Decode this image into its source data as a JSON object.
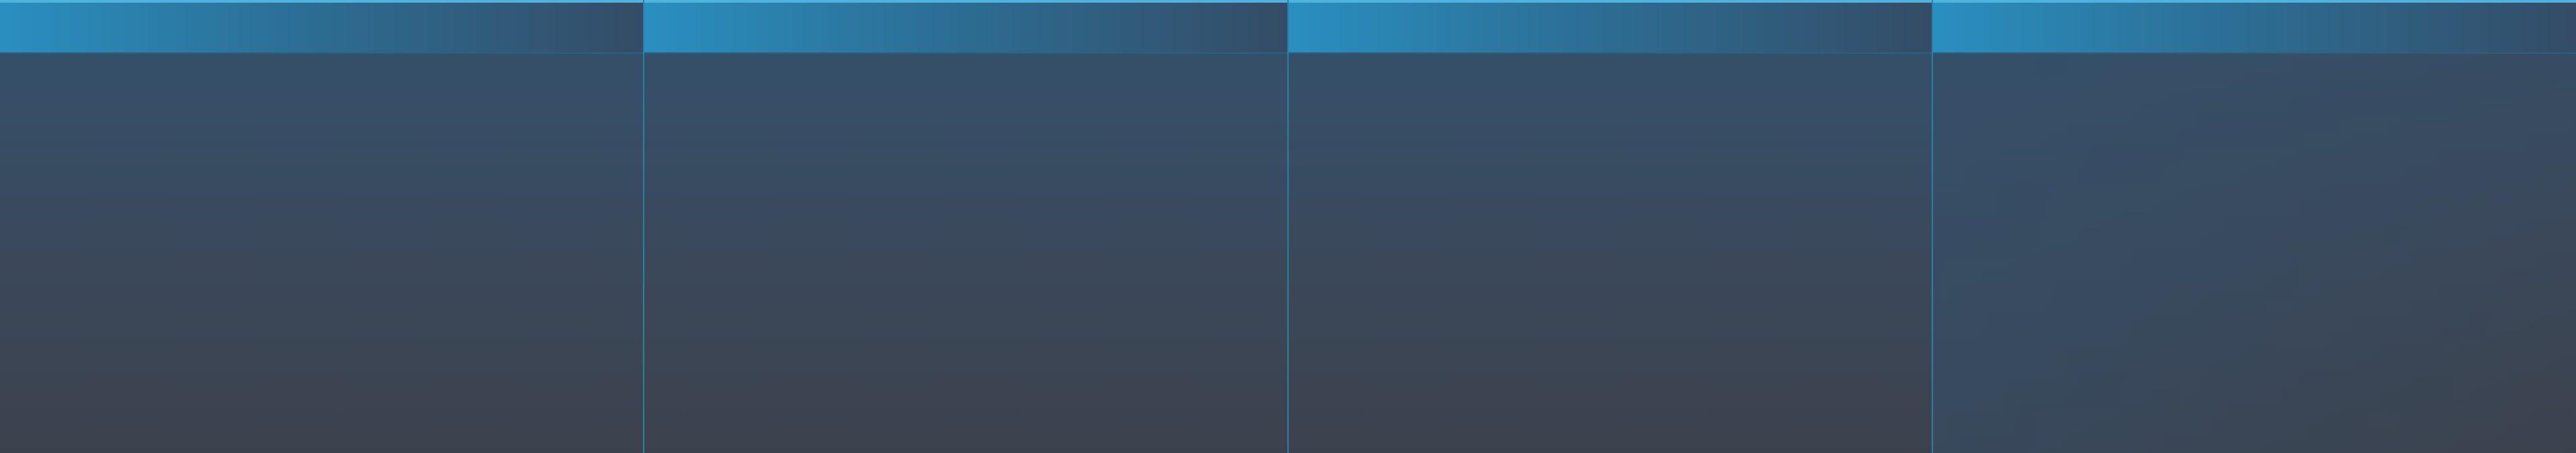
{
  "window": {
    "title": ""
  },
  "panels": [
    {
      "header_label": ""
    },
    {
      "header_label": ""
    },
    {
      "header_label": ""
    },
    {
      "header_label": ""
    }
  ],
  "colors": {
    "header_accent": "#2a8fbf",
    "header_top_line": "#4fb3dd",
    "divider": "#2e7fa6",
    "body_top": "#34506b",
    "body_bottom": "#3c424d"
  }
}
